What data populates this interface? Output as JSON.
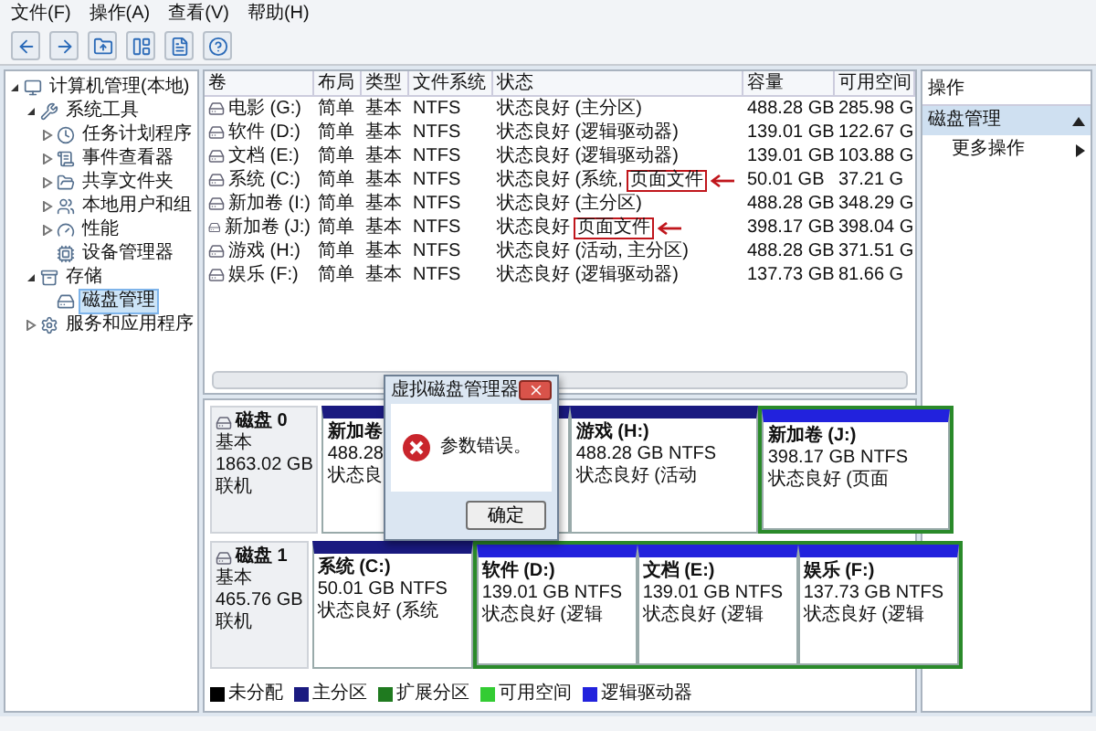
{
  "menu": [
    "文件(F)",
    "操作(A)",
    "查看(V)",
    "帮助(H)"
  ],
  "tree": [
    {
      "label": "计算机管理(本地)",
      "expanded": true,
      "selected": false,
      "children": [
        {
          "label": "系统工具",
          "expanded": true,
          "selected": false,
          "children": [
            {
              "label": "任务计划程序",
              "expanded": false,
              "selected": false
            },
            {
              "label": "事件查看器",
              "expanded": false,
              "selected": false
            },
            {
              "label": "共享文件夹",
              "expanded": false,
              "selected": false
            },
            {
              "label": "本地用户和组",
              "expanded": false,
              "selected": false
            },
            {
              "label": "性能",
              "expanded": false,
              "selected": false
            },
            {
              "label": "设备管理器",
              "selected": false
            }
          ]
        },
        {
          "label": "存储",
          "expanded": true,
          "selected": false,
          "children": [
            {
              "label": "磁盘管理",
              "selected": true
            }
          ]
        },
        {
          "label": "服务和应用程序",
          "expanded": false,
          "selected": false
        }
      ]
    }
  ],
  "table": {
    "columns": [
      "卷",
      "布局",
      "类型",
      "文件系统",
      "状态",
      "容量",
      "可用空间"
    ],
    "rows": [
      {
        "volume": "电影 (G:)",
        "layout": "简单",
        "type": "基本",
        "fs": "NTFS",
        "status": "状态良好 (主分区)",
        "capacity": "488.28 GB",
        "free": "285.98 G"
      },
      {
        "volume": "软件 (D:)",
        "layout": "简单",
        "type": "基本",
        "fs": "NTFS",
        "status": "状态良好 (逻辑驱动器)",
        "capacity": "139.01 GB",
        "free": "122.67 G"
      },
      {
        "volume": "文档 (E:)",
        "layout": "简单",
        "type": "基本",
        "fs": "NTFS",
        "status": "状态良好 (逻辑驱动器)",
        "capacity": "139.01 GB",
        "free": "103.88 G"
      },
      {
        "volume": "系统 (C:)",
        "layout": "简单",
        "type": "基本",
        "fs": "NTFS",
        "status": "状态良好 (系统,",
        "callout": "页面文件",
        "capacity": "50.01 GB",
        "free": "37.21 G"
      },
      {
        "volume": "新加卷 (I:)",
        "layout": "简单",
        "type": "基本",
        "fs": "NTFS",
        "status": "状态良好 (主分区)",
        "capacity": "488.28 GB",
        "free": "348.29 G"
      },
      {
        "volume": "新加卷 (J:)",
        "layout": "简单",
        "type": "基本",
        "fs": "NTFS",
        "status": "状态良好",
        "callout": "页面文件",
        "capacity": "398.17 GB",
        "free": "398.04 G"
      },
      {
        "volume": "游戏 (H:)",
        "layout": "简单",
        "type": "基本",
        "fs": "NTFS",
        "status": "状态良好 (活动, 主分区)",
        "capacity": "488.28 GB",
        "free": "371.51 G"
      },
      {
        "volume": "娱乐 (F:)",
        "layout": "简单",
        "type": "基本",
        "fs": "NTFS",
        "status": "状态良好 (逻辑驱动器)",
        "capacity": "137.73 GB",
        "free": "81.66 G"
      }
    ]
  },
  "disks": [
    {
      "name": "磁盘 0",
      "type": "基本",
      "size": "1863.02 GB",
      "state": "联机",
      "partitions": [
        {
          "name": "新加卷",
          "size": "488.28",
          "status": "状态良",
          "kind": "primary"
        },
        {
          "name": "游戏 (H:)",
          "size": "488.28 GB NTFS",
          "status": "状态良好 (活动",
          "kind": "primary"
        },
        {
          "name": "新加卷 (J:)",
          "size": "398.17 GB NTFS",
          "status": "状态良好 (页面",
          "kind": "logical"
        }
      ]
    },
    {
      "name": "磁盘 1",
      "type": "基本",
      "size": "465.76 GB",
      "state": "联机",
      "partitions": [
        {
          "name": "系统 (C:)",
          "size": "50.01 GB NTFS",
          "status": "状态良好 (系统",
          "kind": "primary"
        },
        {
          "name": "软件 (D:)",
          "size": "139.01 GB NTFS",
          "status": "状态良好 (逻辑",
          "kind": "logical"
        },
        {
          "name": "文档 (E:)",
          "size": "139.01 GB NTFS",
          "status": "状态良好 (逻辑",
          "kind": "logical"
        },
        {
          "name": "娱乐 (F:)",
          "size": "137.73 GB NTFS",
          "status": "状态良好 (逻辑",
          "kind": "logical"
        }
      ]
    }
  ],
  "legend": [
    {
      "label": "未分配",
      "color": "#000000"
    },
    {
      "label": "主分区",
      "color": "#1a1a80"
    },
    {
      "label": "扩展分区",
      "color": "#1f7a1f"
    },
    {
      "label": "可用空间",
      "color": "#33cc33"
    },
    {
      "label": "逻辑驱动器",
      "color": "#2222dd"
    }
  ],
  "dialog": {
    "title": "虚拟磁盘管理器",
    "message": "参数错误。",
    "button": "确定"
  },
  "actions": {
    "title": "操作",
    "section": "磁盘管理",
    "expanded": true,
    "items": [
      "更多操作"
    ]
  }
}
